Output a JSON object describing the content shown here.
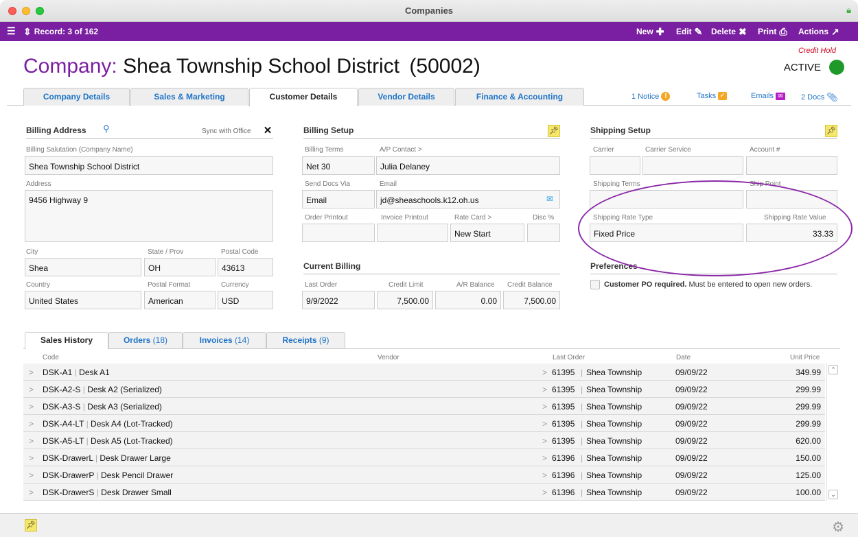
{
  "window": {
    "title": "Companies"
  },
  "toolbar": {
    "record_label": "Record: 3 of 162",
    "new_label": "New",
    "edit_label": "Edit",
    "delete_label": "Delete",
    "print_label": "Print",
    "actions_label": "Actions"
  },
  "header": {
    "title_prefix": "Company:",
    "title_name": "Shea Township School District",
    "title_id": "(50002)",
    "credit_hold": "Credit Hold",
    "status": "ACTIVE",
    "status_color": "#1f9a2a"
  },
  "tabs": [
    {
      "label": "Company Details"
    },
    {
      "label": "Sales & Marketing"
    },
    {
      "label": "Customer Details"
    },
    {
      "label": "Vendor Details"
    },
    {
      "label": "Finance & Accounting"
    }
  ],
  "header_links": {
    "notice": "1 Notice",
    "tasks": "Tasks",
    "emails": "Emails",
    "docs": "2 Docs"
  },
  "billing_address": {
    "heading": "Billing Address",
    "sync_label": "Sync with Office",
    "salutation_label": "Billing Salutation (Company Name)",
    "salutation": "Shea Township School District",
    "address_label": "Address",
    "address": "9456 Highway 9",
    "city_label": "City",
    "city": "Shea",
    "state_label": "State / Prov",
    "state": "OH",
    "postal_label": "Postal Code",
    "postal": "43613",
    "country_label": "Country",
    "country": "United States",
    "postal_format_label": "Postal Format",
    "postal_format": "American",
    "currency_label": "Currency",
    "currency": "USD"
  },
  "billing_setup": {
    "heading": "Billing Setup",
    "terms_label": "Billing Terms",
    "terms": "Net 30",
    "ap_contact_label": "A/P Contact >",
    "ap_contact": "Julia Delaney",
    "send_via_label": "Send Docs Via",
    "send_via": "Email",
    "email_label": "Email",
    "email": "jd@sheaschools.k12.oh.us",
    "order_printout_label": "Order Printout",
    "invoice_printout_label": "Invoice Printout",
    "rate_card_label": "Rate Card >",
    "rate_card": "New Start",
    "disc_label": "Disc %"
  },
  "current_billing": {
    "heading": "Current Billing",
    "last_order_label": "Last Order",
    "last_order": "9/9/2022",
    "credit_limit_label": "Credit Limit",
    "credit_limit": "7,500.00",
    "ar_balance_label": "A/R Balance",
    "ar_balance": "0.00",
    "credit_balance_label": "Credit Balance",
    "credit_balance": "7,500.00"
  },
  "shipping_setup": {
    "heading": "Shipping Setup",
    "carrier_label": "Carrier",
    "carrier_service_label": "Carrier Service",
    "account_label": "Account #",
    "shipping_terms_label": "Shipping Terms",
    "ship_point_label": "Ship Point",
    "rate_type_label": "Shipping Rate Type",
    "rate_type": "Fixed Price",
    "rate_value_label": "Shipping Rate Value",
    "rate_value": "33.33"
  },
  "preferences": {
    "heading": "Preferences",
    "po_required_bold": "Customer PO required.",
    "po_required_note": "Must be entered to open new orders."
  },
  "bottom_tabs": [
    {
      "label": "Sales History",
      "count": ""
    },
    {
      "label": "Orders",
      "count": "(18)"
    },
    {
      "label": "Invoices",
      "count": "(14)"
    },
    {
      "label": "Receipts",
      "count": "(9)"
    }
  ],
  "table": {
    "columns": [
      "Code",
      "Vendor",
      "Last Order",
      "Date",
      "Unit Price"
    ],
    "rows": [
      {
        "code": "DSK-A1",
        "desc": "Desk A1",
        "order": "61395",
        "customer": "Shea Township",
        "date": "09/09/22",
        "price": "349.99"
      },
      {
        "code": "DSK-A2-S",
        "desc": "Desk A2 (Serialized)",
        "order": "61395",
        "customer": "Shea Township",
        "date": "09/09/22",
        "price": "299.99"
      },
      {
        "code": "DSK-A3-S",
        "desc": "Desk A3 (Serialized)",
        "order": "61395",
        "customer": "Shea Township",
        "date": "09/09/22",
        "price": "299.99"
      },
      {
        "code": "DSK-A4-LT",
        "desc": "Desk A4 (Lot-Tracked)",
        "order": "61395",
        "customer": "Shea Township",
        "date": "09/09/22",
        "price": "299.99"
      },
      {
        "code": "DSK-A5-LT",
        "desc": "Desk A5 (Lot-Tracked)",
        "order": "61395",
        "customer": "Shea Township",
        "date": "09/09/22",
        "price": "620.00"
      },
      {
        "code": "DSK-DrawerL",
        "desc": "Desk Drawer Large",
        "order": "61396",
        "customer": "Shea Township",
        "date": "09/09/22",
        "price": "150.00"
      },
      {
        "code": "DSK-DrawerP",
        "desc": "Desk Pencil Drawer",
        "order": "61396",
        "customer": "Shea Township",
        "date": "09/09/22",
        "price": "125.00"
      },
      {
        "code": "DSK-DrawerS",
        "desc": "Desk Drawer Small",
        "order": "61396",
        "customer": "Shea Township",
        "date": "09/09/22",
        "price": "100.00"
      }
    ]
  },
  "colors": {
    "brand": "#7a1fa2",
    "link": "#1f73c7",
    "credit_hold": "#d0021b"
  }
}
